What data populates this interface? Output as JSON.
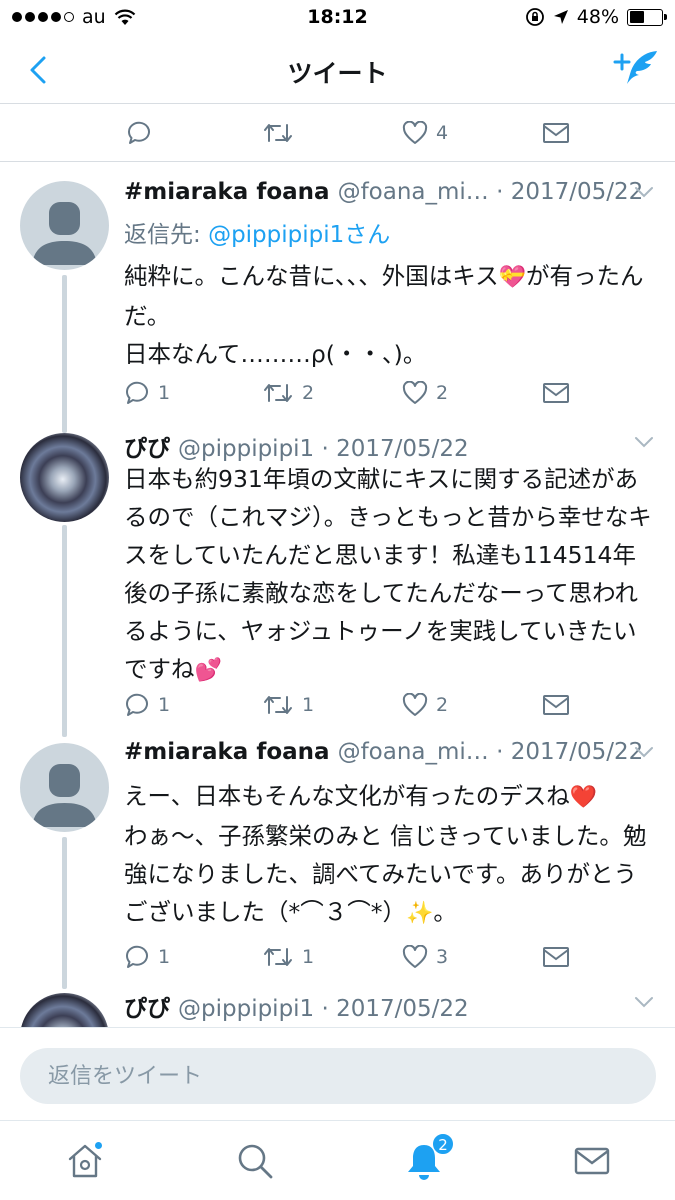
{
  "status_bar": {
    "carrier": "au",
    "time": "18:12",
    "battery": "48%",
    "battery_level": 0.48
  },
  "nav": {
    "title": "ツイート"
  },
  "top_actions": {
    "replies": "",
    "retweets": "",
    "likes": "4"
  },
  "tweets": [
    {
      "name": "#miaraka foana",
      "meta": "@foana_mi… · 2017/05/22",
      "reply_to_prefix": "返信先: ",
      "reply_to_mention": "@pippipipi1さん",
      "text_1": "純粋に。こんな昔に、、、外国はキス",
      "emoji_1": "💝",
      "text_2": "が有ったんだ。\n日本なんて………ρ(・・、)。",
      "replies": "1",
      "retweets": "2",
      "likes": "2"
    },
    {
      "name": "ぴぴ",
      "meta": "@pippipipi1 · 2017/05/22",
      "text_1": "日本も約931年頃の文献にキスに関する記述があるので（これマジ）。きっともっと昔から幸せなキスをしていたんだと思います！私達も114514年後の子孫に素敵な恋をしてたんだなーって思われるように、ヤォジュトゥーノを実践していきたいですね",
      "emoji_1": "💕",
      "replies": "1",
      "retweets": "1",
      "likes": "2"
    },
    {
      "name": "#miaraka foana",
      "meta": "@foana_mi… · 2017/05/22",
      "text_1": "えー、日本もそんな文化が有ったのデスね",
      "emoji_1": "❤️",
      "text_2": "\nわぁ～、子孫繁栄のみと 信じきっていました。勉強になりました、調べてみたいです。ありがとうございました（*⌒３⌒*）",
      "emoji_2": "✨",
      "text_3": "。",
      "replies": "1",
      "retweets": "1",
      "likes": "3"
    },
    {
      "name": "ぴぴ",
      "meta": "@pippipipi1 · 2017/05/22"
    }
  ],
  "reply_bar": {
    "placeholder": "返信をツイート"
  },
  "tabbar": {
    "notifications_badge": "2"
  },
  "colors": {
    "accent": "#1da1f2",
    "secondary_text": "#657786",
    "thread_line": "#ccd6dd"
  }
}
